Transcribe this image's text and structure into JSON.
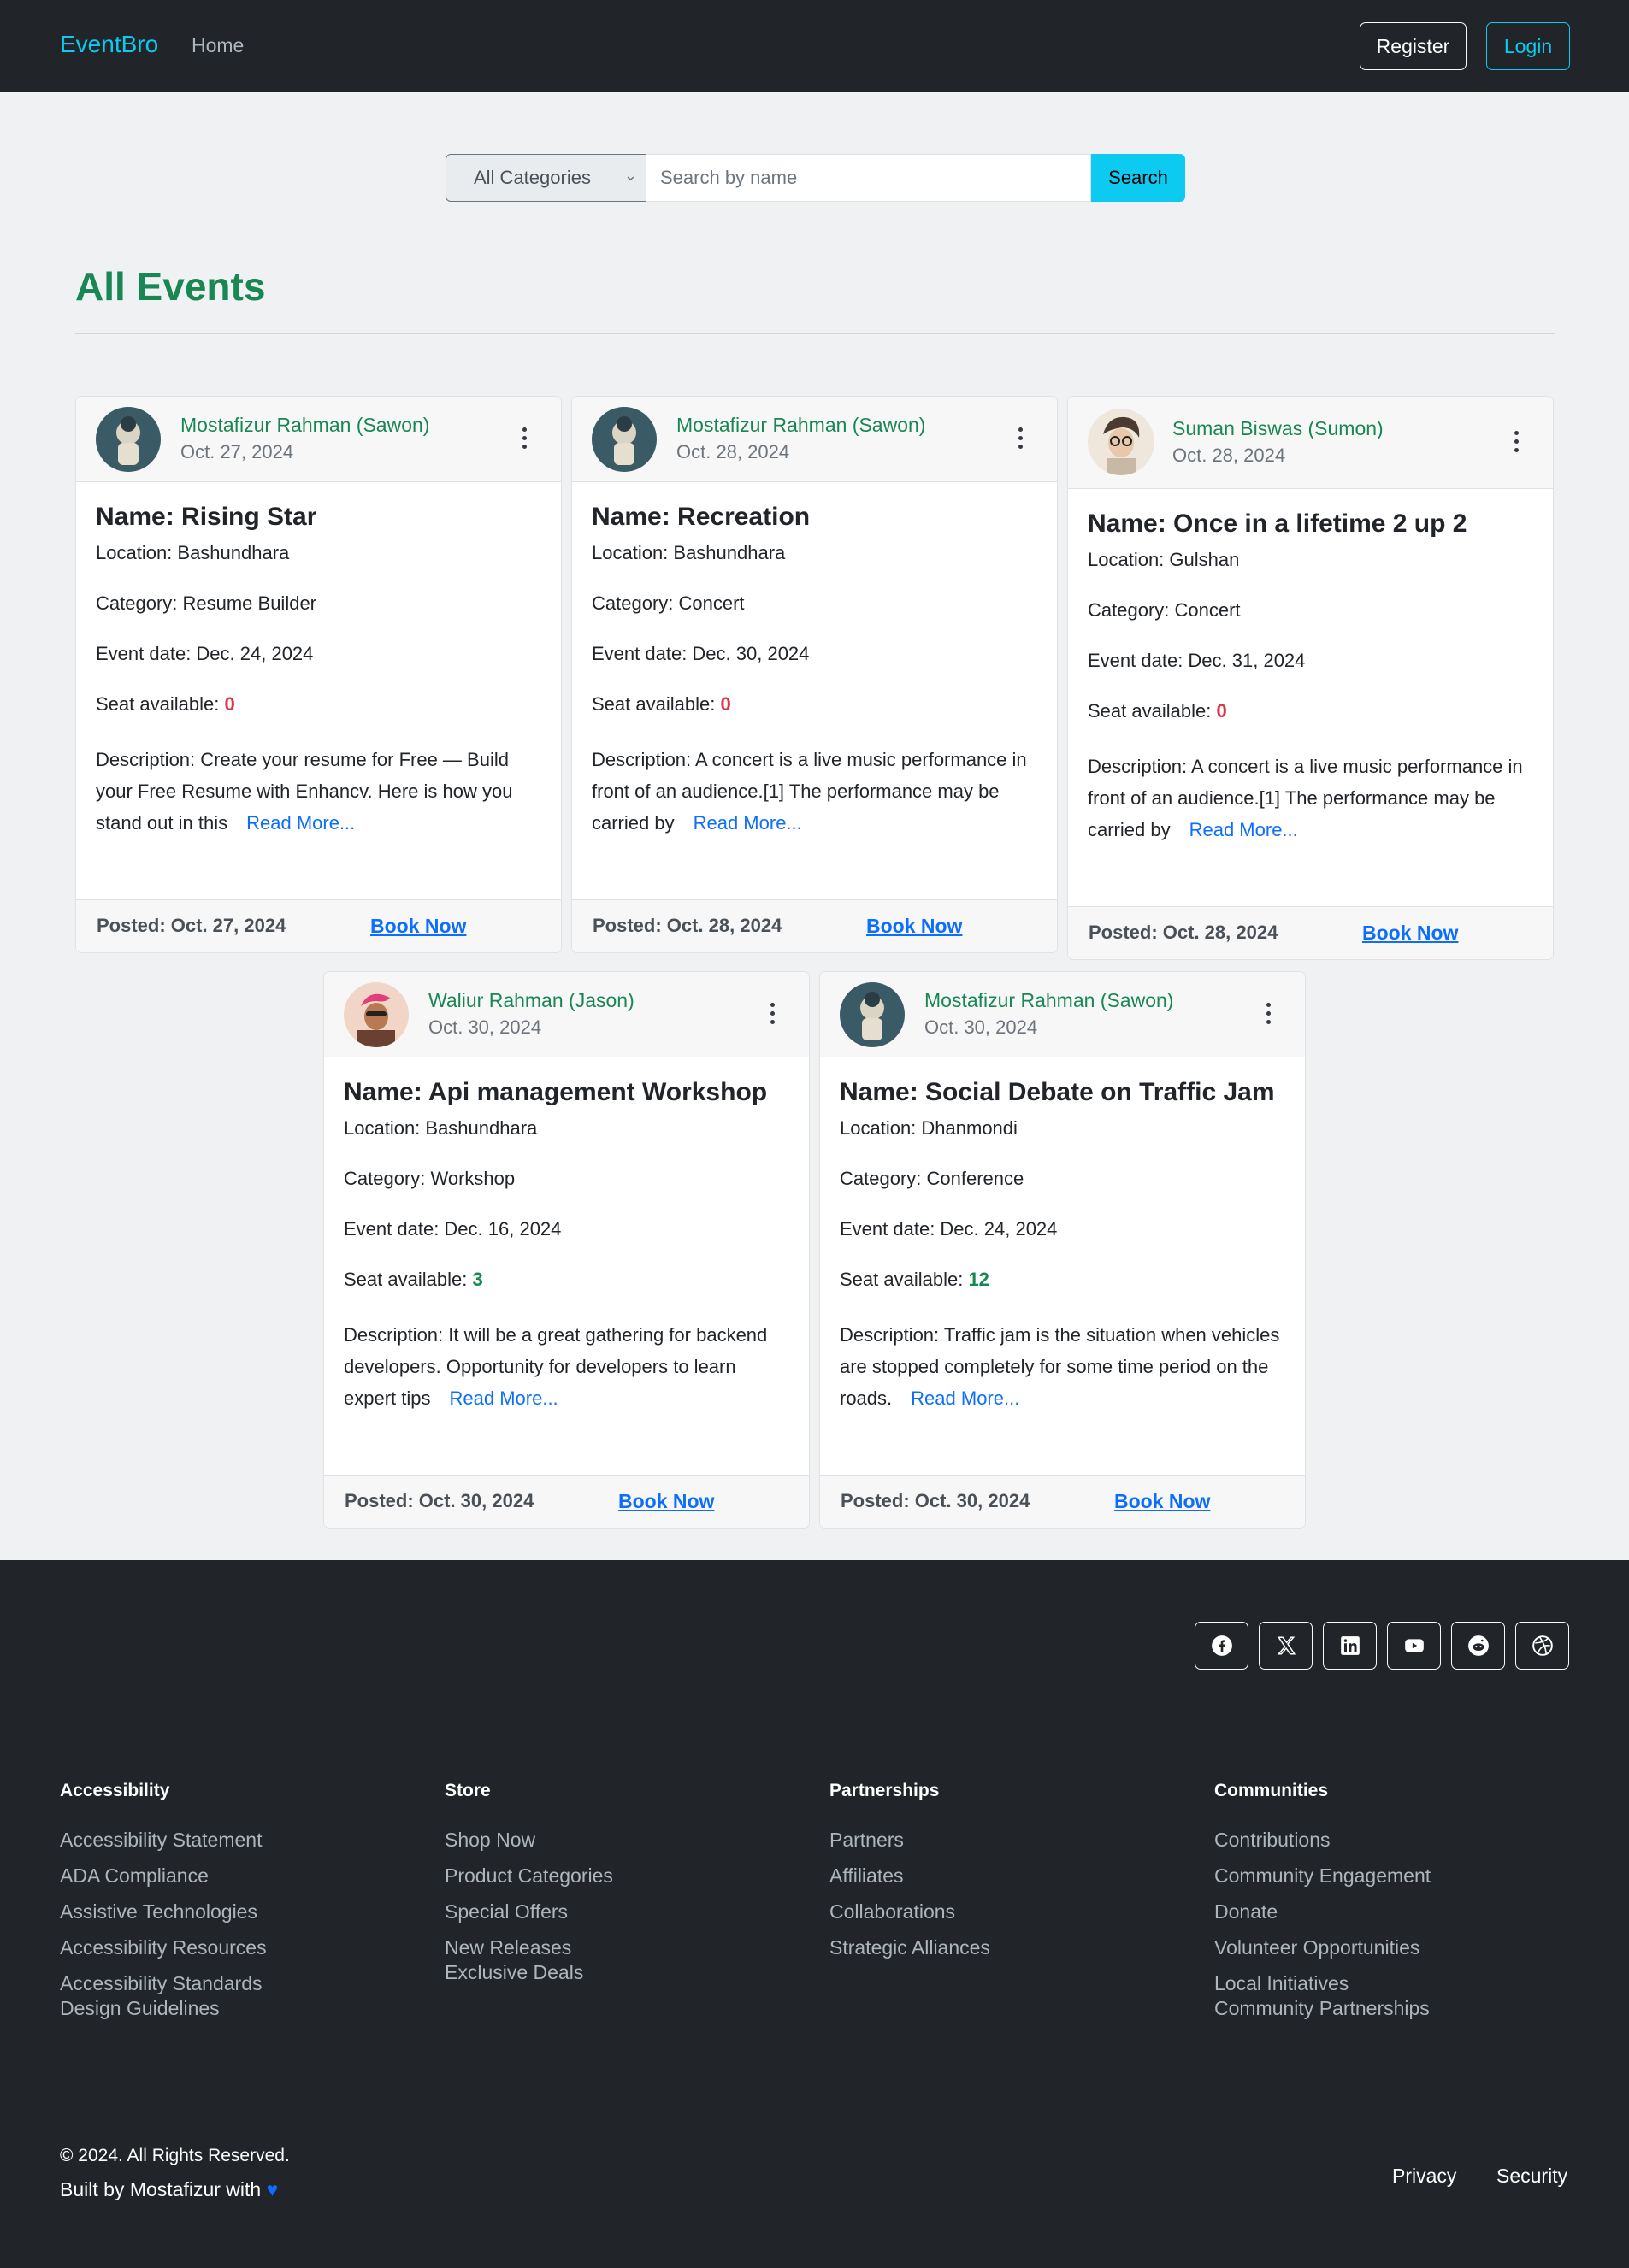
{
  "navbar": {
    "brand": "EventBro",
    "home": "Home",
    "register": "Register",
    "login": "Login"
  },
  "search": {
    "category_selected": "All Categories",
    "placeholder": "Search by name",
    "button": "Search"
  },
  "page_title": "All Events",
  "events": [
    {
      "author": "Mostafizur Rahman (Sawon)",
      "post_date": "Oct. 27, 2024",
      "name": "Name: Rising Star",
      "location": "Location: Bashundhara",
      "category": "Category: Resume Builder",
      "event_date": "Event date: Dec. 24, 2024",
      "seat_label": "Seat available: ",
      "seats": "0",
      "description": "Description: Create your resume for Free — Build your Free Resume with Enhancv. Here is how you stand out in this",
      "read_more": "Read More...",
      "posted": "Posted: Oct. 27, 2024",
      "book": "Book Now"
    },
    {
      "author": "Mostafizur Rahman (Sawon)",
      "post_date": "Oct. 28, 2024",
      "name": "Name: Recreation",
      "location": "Location: Bashundhara",
      "category": "Category: Concert",
      "event_date": "Event date: Dec. 30, 2024",
      "seat_label": "Seat available: ",
      "seats": "0",
      "description": "Description: A concert is a live music performance in front of an audience.[1] The performance may be carried by",
      "read_more": "Read More...",
      "posted": "Posted: Oct. 28, 2024",
      "book": "Book Now"
    },
    {
      "author": "Suman Biswas (Sumon)",
      "post_date": "Oct. 28, 2024",
      "name": "Name: Once in a lifetime 2 up 2",
      "location": "Location: Gulshan",
      "category": "Category: Concert",
      "event_date": "Event date: Dec. 31, 2024",
      "seat_label": "Seat available: ",
      "seats": "0",
      "description": "Description: A concert is a live music performance in front of an audience.[1] The performance may be carried by",
      "read_more": "Read More...",
      "posted": "Posted: Oct. 28, 2024",
      "book": "Book Now"
    },
    {
      "author": "Waliur Rahman (Jason)",
      "post_date": "Oct. 30, 2024",
      "name": "Name: Api management Workshop",
      "location": "Location: Bashundhara",
      "category": "Category: Workshop",
      "event_date": "Event date: Dec. 16, 2024",
      "seat_label": "Seat available: ",
      "seats": "3",
      "description": "Description: It will be a great gathering for backend developers. Opportunity for developers to learn expert tips",
      "read_more": "Read More...",
      "posted": "Posted: Oct. 30, 2024",
      "book": "Book Now"
    },
    {
      "author": "Mostafizur Rahman (Sawon)",
      "post_date": "Oct. 30, 2024",
      "name": "Name: Social Debate on Traffic Jam",
      "location": "Location: Dhanmondi",
      "category": "Category: Conference",
      "event_date": "Event date: Dec. 24, 2024",
      "seat_label": "Seat available: ",
      "seats": "12",
      "description": "Description: Traffic jam is the situation when vehicles are stopped completely for some time period on the roads.",
      "read_more": "Read More...",
      "posted": "Posted: Oct. 30, 2024",
      "book": "Book Now"
    }
  ],
  "colors": {
    "brand": "#0dcaf0",
    "success": "#198754",
    "danger": "#dc3545",
    "link": "#0d6efd",
    "dark": "#212529"
  },
  "footer": {
    "socials": [
      "facebook-icon",
      "x-icon",
      "linkedin-icon",
      "youtube-icon",
      "reddit-icon",
      "dribbble-icon"
    ],
    "columns": [
      {
        "heading": "Accessibility",
        "links": [
          "Accessibility Statement",
          "ADA Compliance",
          "Assistive Technologies",
          "Accessibility Resources",
          "Accessibility Standards",
          "Design Guidelines"
        ]
      },
      {
        "heading": "Store",
        "links": [
          "Shop Now",
          "Product Categories",
          "Special Offers",
          "New Releases",
          "Exclusive Deals"
        ]
      },
      {
        "heading": "Partnerships",
        "links": [
          "Partners",
          "Affiliates",
          "Collaborations",
          "Strategic Alliances"
        ]
      },
      {
        "heading": "Communities",
        "links": [
          "Contributions",
          "Community Engagement",
          "Donate",
          "Volunteer Opportunities",
          "Local Initiatives",
          "Community Partnerships"
        ]
      }
    ],
    "copyright": "© 2024. All Rights Reserved.",
    "built_by": "Built by Mostafizur with ",
    "heart": "♥",
    "privacy": "Privacy",
    "security": "Security"
  }
}
